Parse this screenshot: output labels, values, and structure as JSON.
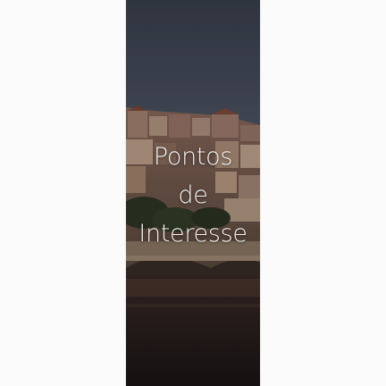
{
  "banner": {
    "title_lines": [
      "Pontos",
      "de",
      "Interesse"
    ]
  },
  "colors": {
    "page_background": "#fbfbfb",
    "sky": "#3d4654",
    "title_text": "#f2f2f2"
  }
}
